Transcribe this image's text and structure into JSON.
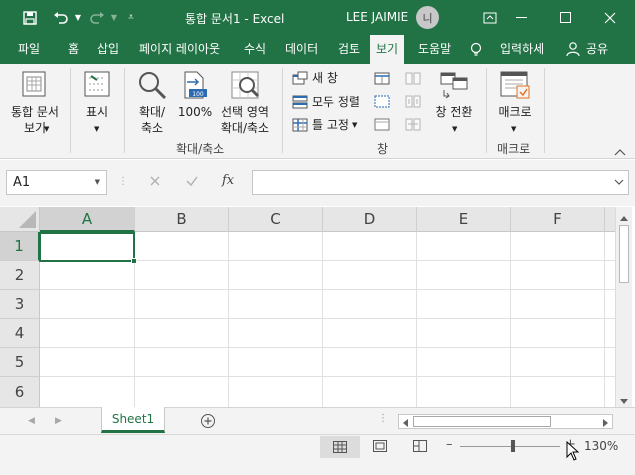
{
  "titlebar": {
    "title": "통합 문서1  -  Excel",
    "user": "LEE JAIMIE",
    "avatar_initial": "니"
  },
  "tabs": [
    "파일",
    "홈",
    "삽입",
    "페이지 레이아웃",
    "수식",
    "데이터",
    "검토",
    "보기",
    "도움말",
    "입력하세",
    "공유"
  ],
  "active_tab": "보기",
  "ribbon": {
    "workbook_view": "통합 문서 보기",
    "show": "표시",
    "zoom": "확대/축소",
    "zoom100": "100%",
    "zoom_selection": "선택 영역 확대/축소",
    "zoom_group": "확대/축소",
    "new_window": "새 창",
    "arrange_all": "모두 정렬",
    "freeze_panes": "틀 고정",
    "switch_windows": "창 전환",
    "window_group": "창",
    "macros": "매크로",
    "macros_group": "매크로"
  },
  "formula_bar": {
    "name_box": "A1",
    "fx": "fx",
    "formula": ""
  },
  "grid": {
    "columns": [
      "A",
      "B",
      "C",
      "D",
      "E",
      "F"
    ],
    "rows": [
      "1",
      "2",
      "3",
      "4",
      "5",
      "6"
    ],
    "selected_cell": "A1"
  },
  "sheets": [
    "Sheet1"
  ],
  "status": {
    "zoom_level": "130%"
  }
}
